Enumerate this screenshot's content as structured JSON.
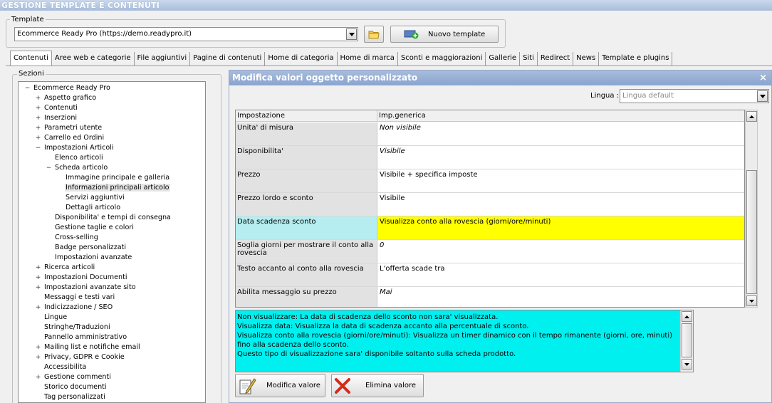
{
  "window": {
    "title": "GESTIONE TEMPLATE E CONTENUTI"
  },
  "template": {
    "legend": "Template",
    "selected": "Ecommerce Ready Pro (https://demo.readypro.it)",
    "new_label": "Nuovo template"
  },
  "tabs": [
    {
      "label": "Contenuti",
      "active": true
    },
    {
      "label": "Aree web e categorie"
    },
    {
      "label": "File aggiuntivi"
    },
    {
      "label": "Pagine di contenuti"
    },
    {
      "label": "Home di categoria"
    },
    {
      "label": "Home di marca"
    },
    {
      "label": "Sconti e maggiorazioni"
    },
    {
      "label": "Gallerie"
    },
    {
      "label": "Siti"
    },
    {
      "label": "Redirect"
    },
    {
      "label": "News"
    },
    {
      "label": "Template e plugins"
    }
  ],
  "sections": {
    "legend": "Sezioni",
    "items": [
      {
        "label": "Ecommerce Ready Pro",
        "level": 0,
        "exp": "−"
      },
      {
        "label": "Aspetto grafico",
        "level": 1,
        "exp": "+"
      },
      {
        "label": "Contenuti",
        "level": 1,
        "exp": "+"
      },
      {
        "label": "Inserzioni",
        "level": 1,
        "exp": "+"
      },
      {
        "label": "Parametri utente",
        "level": 1,
        "exp": "+"
      },
      {
        "label": "Carrello ed Ordini",
        "level": 1,
        "exp": "+"
      },
      {
        "label": "Impostazioni Articoli",
        "level": 1,
        "exp": "−"
      },
      {
        "label": "Elenco articoli",
        "level": 2,
        "exp": ""
      },
      {
        "label": "Scheda articolo",
        "level": 2,
        "exp": "−"
      },
      {
        "label": "Immagine principale e galleria",
        "level": 3,
        "exp": ""
      },
      {
        "label": "Informazioni principali articolo",
        "level": 3,
        "exp": "",
        "selected": true
      },
      {
        "label": "Servizi aggiuntivi",
        "level": 3,
        "exp": ""
      },
      {
        "label": "Dettagli articolo",
        "level": 3,
        "exp": ""
      },
      {
        "label": "Disponibilita' e tempi di consegna",
        "level": 2,
        "exp": ""
      },
      {
        "label": "Gestione taglie e colori",
        "level": 2,
        "exp": ""
      },
      {
        "label": "Cross-selling",
        "level": 2,
        "exp": ""
      },
      {
        "label": "Badge personalizzati",
        "level": 2,
        "exp": ""
      },
      {
        "label": "Impostazioni avanzate",
        "level": 2,
        "exp": ""
      },
      {
        "label": "Ricerca articoli",
        "level": 1,
        "exp": "+"
      },
      {
        "label": "Impostazioni Documenti",
        "level": 1,
        "exp": "+"
      },
      {
        "label": "Impostazioni avanzate sito",
        "level": 1,
        "exp": "+"
      },
      {
        "label": "Messaggi e testi vari",
        "level": 1,
        "exp": ""
      },
      {
        "label": "Indicizzazione / SEO",
        "level": 1,
        "exp": "+"
      },
      {
        "label": "Lingue",
        "level": 1,
        "exp": ""
      },
      {
        "label": "Stringhe/Traduzioni",
        "level": 1,
        "exp": ""
      },
      {
        "label": "Pannello amministrativo",
        "level": 1,
        "exp": ""
      },
      {
        "label": "Mailing list e notifiche email",
        "level": 1,
        "exp": "+"
      },
      {
        "label": "Privacy, GDPR e Cookie",
        "level": 1,
        "exp": "+"
      },
      {
        "label": "Accessibilita",
        "level": 1,
        "exp": ""
      },
      {
        "label": "Gestione commenti",
        "level": 1,
        "exp": "+"
      },
      {
        "label": "Storico documenti",
        "level": 1,
        "exp": ""
      },
      {
        "label": "Tag personalizzati",
        "level": 1,
        "exp": ""
      }
    ]
  },
  "panel": {
    "title": "Modifica valori oggetto personalizzato",
    "lingua_label": "Lingua :",
    "lingua_value": "Lingua default",
    "col_setting": "Impostazione",
    "col_value": "Imp.generica",
    "rows": [
      {
        "setting": "Unita' di misura",
        "value": "Non visibile",
        "italic": true
      },
      {
        "setting": "Disponibilita'",
        "value": "Visibile",
        "italic": true
      },
      {
        "setting": "Prezzo",
        "value": "Visibile + specifica imposte"
      },
      {
        "setting": "Prezzo lordo e sconto",
        "value": "Visibile"
      },
      {
        "setting": "Data scadenza sconto",
        "value": "Visualizza conto alla rovescia (giorni/ore/minuti)",
        "highlight": true
      },
      {
        "setting": "Soglia giorni per mostrare il conto alla rovescia",
        "value": "0",
        "italic": true
      },
      {
        "setting": "Testo accanto al conto alla rovescia",
        "value": "L'offerta scade tra"
      },
      {
        "setting": "Abilita messaggio su prezzo",
        "value": "Mai",
        "italic": true
      }
    ],
    "description": [
      "Non visualizzare: La data di scadenza dello sconto non sara' visualizzata.",
      "Visualizza data: Visualizza la data di scadenza accanto alla percentuale di sconto.",
      "Visualizza conto alla rovescia (giorni/ore/minuti): Visualizza un timer dinamico con il tempo rimanente (giorni, ore, minuti) fino alla scadenza dello sconto.",
      "Questo tipo di visualizzazione sara' disponibile soltanto sulla scheda prodotto."
    ],
    "edit_label": "Modifica valore",
    "delete_label": "Elimina valore"
  },
  "colors": {
    "highlight_value": "#ffff00",
    "highlight_setting": "#b5edf0",
    "description_bg": "#00f0f0",
    "header": "#8aa4cf"
  }
}
